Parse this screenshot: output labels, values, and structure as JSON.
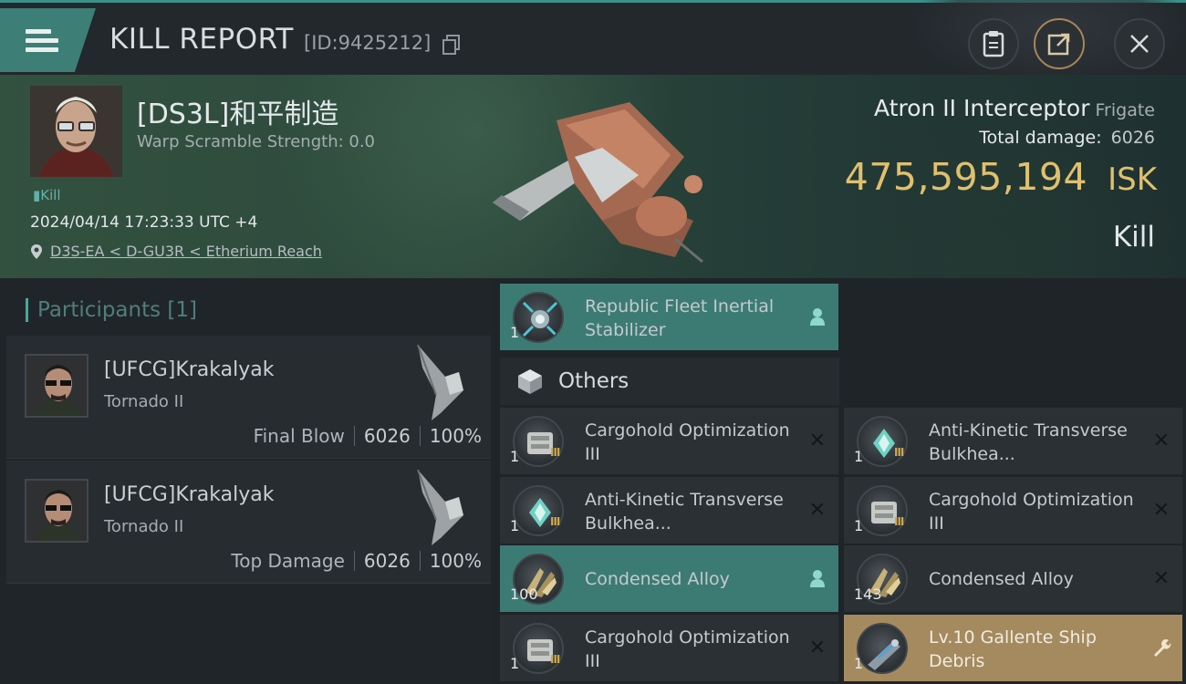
{
  "header": {
    "title": "KILL REPORT",
    "kill_id": "[ID:9425212]",
    "icons": [
      "menu-icon",
      "copy-icon",
      "clipboard-icon",
      "share-icon",
      "close-icon"
    ]
  },
  "victim": {
    "name": "[DS3L]和平制造",
    "warp_scramble": "Warp Scramble Strength: 0.0",
    "kill_tag": "Kill",
    "timestamp": "2024/04/14 17:23:33 UTC +4",
    "location": "D3S-EA < D-GU3R < Etherium Reach",
    "ship_name": "Atron II Interceptor",
    "ship_class": "Frigate",
    "total_damage_label": "Total damage:",
    "total_damage_value": "6026",
    "isk_value": "475,595,194",
    "isk_currency": "ISK",
    "result": "Kill"
  },
  "participants": {
    "label": "Participants",
    "count": "[1]",
    "list": [
      {
        "name": "[UFCG]Krakalyak",
        "ship": "Tornado II",
        "role": "Final Blow",
        "damage": "6026",
        "percent": "100%"
      },
      {
        "name": "[UFCG]Krakalyak",
        "ship": "Tornado II",
        "role": "Top Damage",
        "damage": "6026",
        "percent": "100%"
      }
    ]
  },
  "items": {
    "top": {
      "name": "Republic Fleet Inertial Stabilizer",
      "qty": "1",
      "action": "person-icon"
    },
    "others_label": "Others",
    "list": [
      {
        "name": "Cargohold Optimization III",
        "qty": "1",
        "tier": "III",
        "action": "close-icon"
      },
      {
        "name": "Anti-Kinetic Transverse Bulkhea...",
        "qty": "1",
        "tier": "III",
        "action": "close-icon"
      },
      {
        "name": "Anti-Kinetic Transverse Bulkhea...",
        "qty": "1",
        "tier": "III",
        "action": "close-icon"
      },
      {
        "name": "Cargohold Optimization III",
        "qty": "1",
        "tier": "III",
        "action": "close-icon"
      },
      {
        "name": "Condensed Alloy",
        "qty": "100",
        "action": "person-icon"
      },
      {
        "name": "Condensed Alloy",
        "qty": "143",
        "action": "close-icon"
      },
      {
        "name": "Cargohold Optimization III",
        "qty": "1",
        "tier": "III",
        "action": "close-icon"
      },
      {
        "name": "Lv.10 Gallente Ship Debris",
        "qty": "1",
        "action": "wrench-icon"
      }
    ]
  },
  "colors": {
    "accent_teal": "#3c7b74",
    "isk_gold": "#e0c06e",
    "debris_gold": "#a48a5e"
  }
}
